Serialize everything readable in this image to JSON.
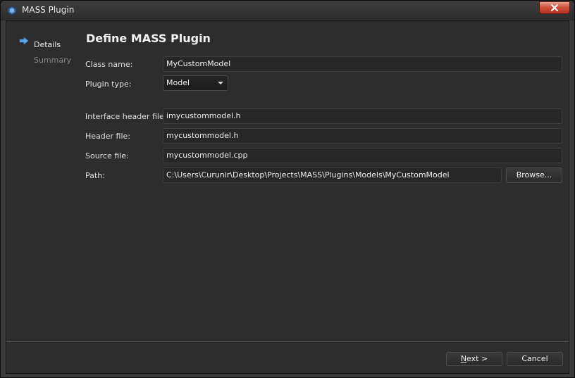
{
  "window": {
    "title": "MASS Plugin"
  },
  "sidebar": {
    "items": [
      {
        "label": "Details",
        "active": true
      },
      {
        "label": "Summary",
        "active": false
      }
    ]
  },
  "page": {
    "title": "Define MASS Plugin"
  },
  "form": {
    "class_name": {
      "label": "Class name:",
      "value": "MyCustomModel"
    },
    "plugin_type": {
      "label": "Plugin type:",
      "value": "Model"
    },
    "interface_header": {
      "label": "Interface header file:",
      "value": "imycustommodel.h"
    },
    "header": {
      "label": "Header file:",
      "value": "mycustommodel.h"
    },
    "source": {
      "label": "Source file:",
      "value": "mycustommodel.cpp"
    },
    "path": {
      "label": "Path:",
      "value": "C:\\Users\\Curunir\\Desktop\\Projects\\MASS\\Plugins\\Models\\MyCustomModel"
    },
    "browse_label": "Browse..."
  },
  "footer": {
    "next_mnemonic": "N",
    "next_rest": "ext >",
    "cancel_label": "Cancel"
  },
  "colors": {
    "background": "#2d2d2d",
    "field_background": "#272727",
    "accent_arrow": "#5da9f0",
    "close_button": "#c7412b"
  },
  "icons": [
    "app-icon",
    "close-icon",
    "arrow-right-icon",
    "dropdown-arrow-icon"
  ]
}
